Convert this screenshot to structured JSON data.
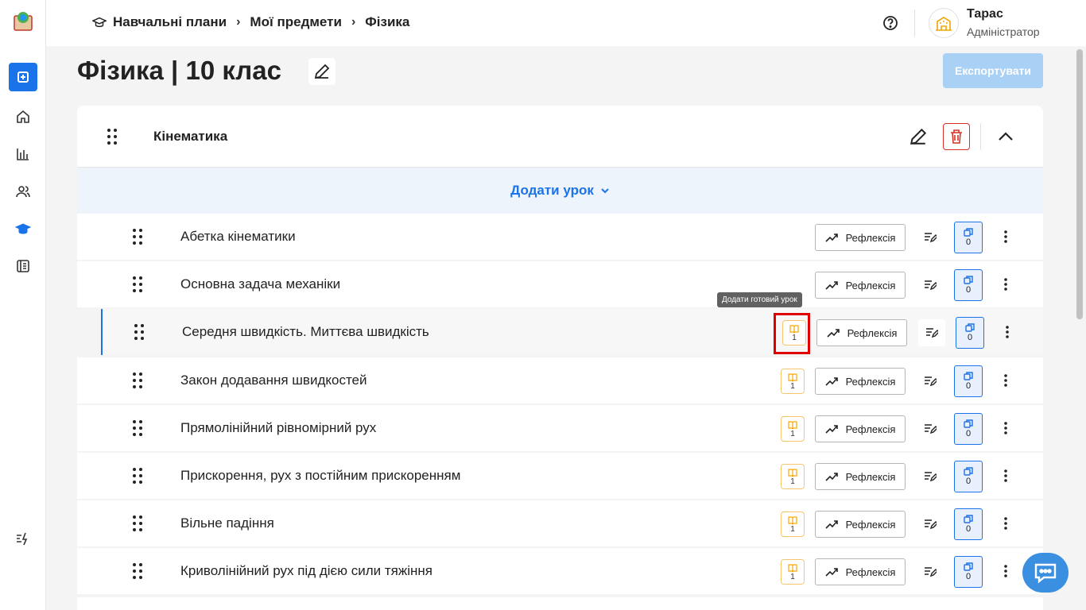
{
  "breadcrumb": [
    "Навчальні плани",
    "Мої предмети",
    "Фізика"
  ],
  "user": {
    "name": "Тарас",
    "role": "Адміністратор"
  },
  "page": {
    "title": "Фізика | 10 клас",
    "export_label": "Експортувати"
  },
  "section": {
    "title": "Кінематика",
    "add_lesson_label": "Додати урок"
  },
  "tooltip": "Додати готовий урок",
  "reflection_label": "Рефлексія",
  "lessons": [
    {
      "title": "Абетка кінематики",
      "books": null,
      "copies": "0"
    },
    {
      "title": "Основна задача механіки",
      "books": null,
      "copies": "0"
    },
    {
      "title": "Середня швидкість. Миттєва швидкість",
      "books": "1",
      "copies": "0"
    },
    {
      "title": "Закон додавання швидкостей",
      "books": "1",
      "copies": "0"
    },
    {
      "title": "Прямолінійний рівномірний рух",
      "books": "1",
      "copies": "0"
    },
    {
      "title": "Прискорення, рух з постійним прискоренням",
      "books": "1",
      "copies": "0"
    },
    {
      "title": "Вільне падіння",
      "books": "1",
      "copies": "0"
    },
    {
      "title": "Криволінійний рух під дією сили тяжіння",
      "books": "1",
      "copies": "0"
    }
  ],
  "colors": {
    "accent": "#1a73e8",
    "danger": "#d93025",
    "book": "#f7a800"
  }
}
